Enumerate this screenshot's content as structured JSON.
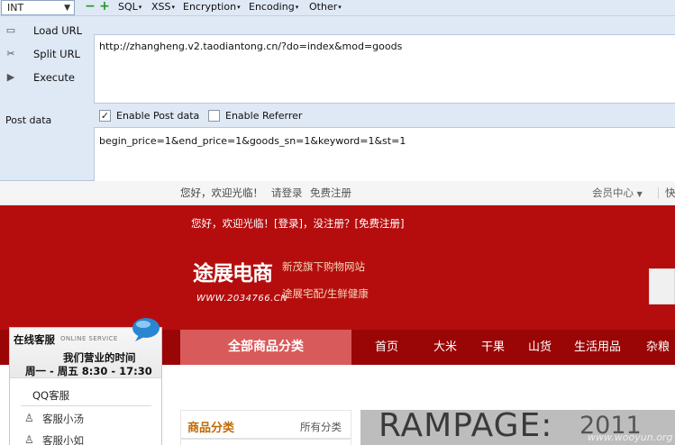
{
  "hackbar": {
    "select_value": "INT",
    "menus": [
      "SQL",
      "XSS",
      "Encryption",
      "Encoding",
      "Other"
    ],
    "buttons": {
      "load": "Load URL",
      "split": "Split URL",
      "execute": "Execute"
    },
    "url": "http://zhangheng.v2.taodiantong.cn/?do=index&mod=goods",
    "checks": {
      "post": "Enable Post data",
      "referrer": "Enable Referrer"
    },
    "post_label": "Post data",
    "post_data": "begin_price=1&end_price=1&goods_sn=1&keyword=1&st=1"
  },
  "topbar": {
    "welcome": "您好，欢迎光临！",
    "login": "请登录",
    "register": "免费注册",
    "member": "会员中心",
    "fast": "快"
  },
  "header": {
    "hello": "您好，欢迎光临！[登录]，没注册？[免费注册]",
    "logo_text": "途展电商",
    "logo_url": "WWW.2034766.CN",
    "slogan1": "新茂旗下购物网站",
    "slogan2": "途展宅配/生鲜健康"
  },
  "nav": {
    "all": "全部商品分类",
    "items": [
      "首页",
      "大米",
      "干果",
      "山货",
      "生活用品",
      "杂粮"
    ]
  },
  "service": {
    "title": "在线客服",
    "title_en": "ONLINE SERVICE",
    "hours_title": "我们营业的时间",
    "hours": "周一 - 周五 8:30 - 17:30",
    "qq_title": "QQ客服",
    "agents": [
      "客服小汤",
      "客服小如"
    ]
  },
  "category": {
    "title": "商品分类",
    "all": "所有分类"
  },
  "banner": {
    "text": "RAMPAGE:",
    "year": "2011",
    "watermark": "www.wooyun.org"
  },
  "colors": {
    "hackbar_bg": "#dfe8f5",
    "header_red": "#b50d0d",
    "nav_red": "#9a0606",
    "nav_all": "#d95a5a"
  }
}
